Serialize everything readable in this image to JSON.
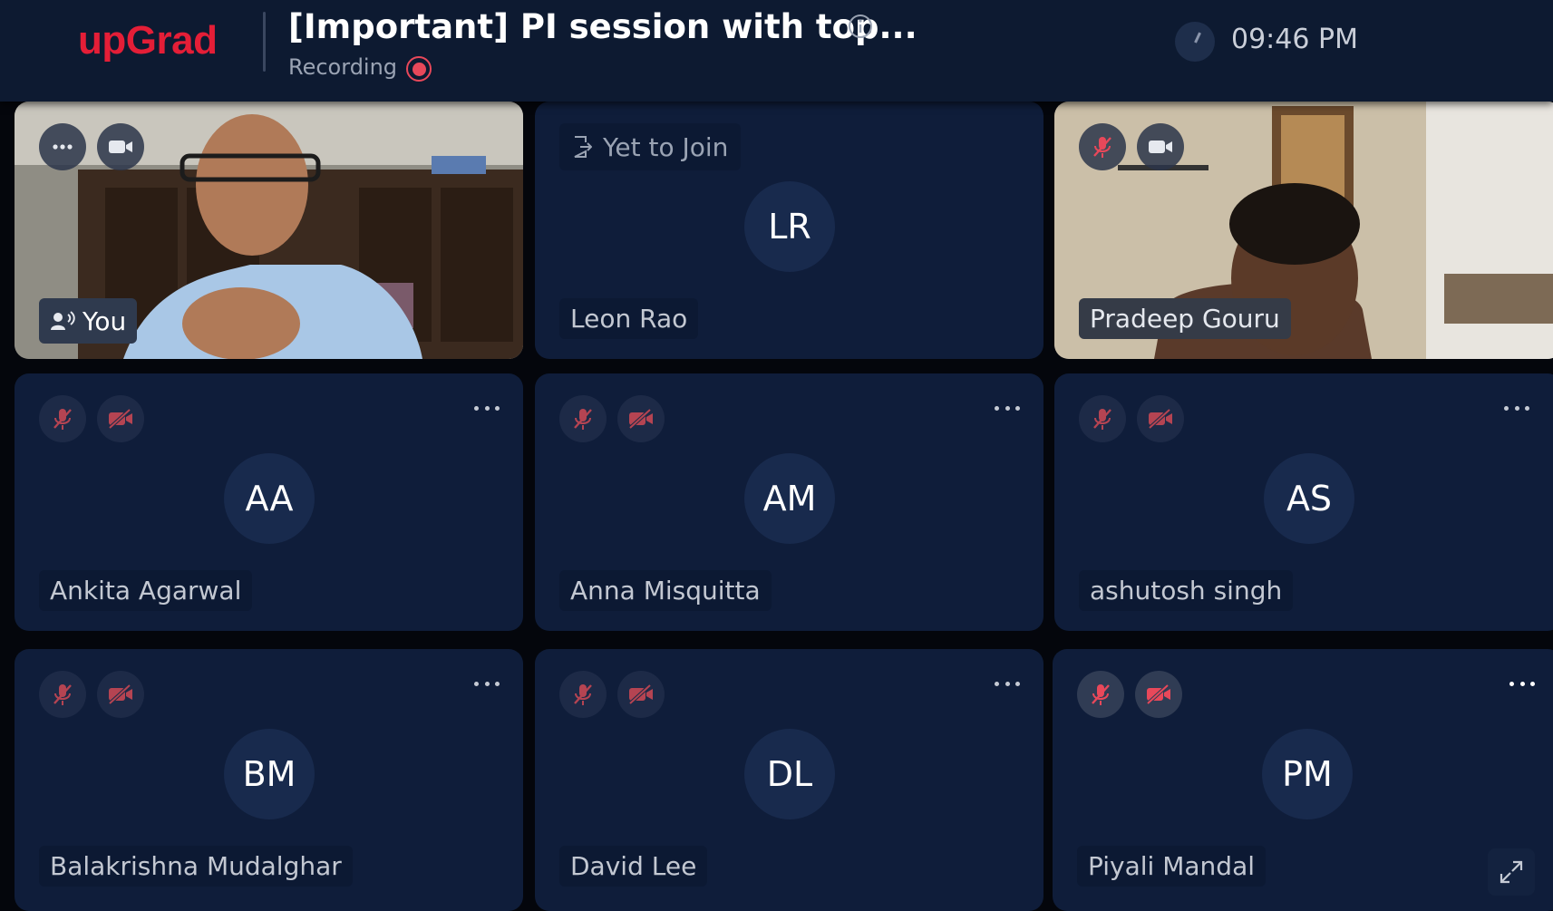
{
  "header": {
    "logo": "upGrad",
    "title": "[Important] PI session with top...",
    "recording_label": "Recording",
    "time": "09:46 PM"
  },
  "colors": {
    "brand": "#e41e37",
    "recording": "#e8485a",
    "muted_red": "#e8485a",
    "background": "#0f1d3a"
  },
  "participants": [
    {
      "name": "You",
      "initials": "",
      "video": true,
      "badge": "speaker-icon"
    },
    {
      "name": "Leon Rao",
      "initials": "LR",
      "video": false,
      "status": "Yet to Join"
    },
    {
      "name": "Pradeep Gouru",
      "initials": "",
      "video": true,
      "mic": "muted"
    },
    {
      "name": "Ankita Agarwal",
      "initials": "AA",
      "video": false,
      "mic": "muted",
      "cam": "off"
    },
    {
      "name": "Anna Misquitta",
      "initials": "AM",
      "video": false,
      "mic": "muted",
      "cam": "off"
    },
    {
      "name": "ashutosh singh",
      "initials": "AS",
      "video": false,
      "mic": "muted",
      "cam": "off"
    },
    {
      "name": "Balakrishna Mudalghar",
      "initials": "BM",
      "video": false,
      "mic": "muted",
      "cam": "off"
    },
    {
      "name": "David Lee",
      "initials": "DL",
      "video": false,
      "mic": "muted",
      "cam": "off"
    },
    {
      "name": "Piyali Mandal",
      "initials": "PM",
      "video": false,
      "mic": "muted",
      "cam": "off"
    }
  ]
}
